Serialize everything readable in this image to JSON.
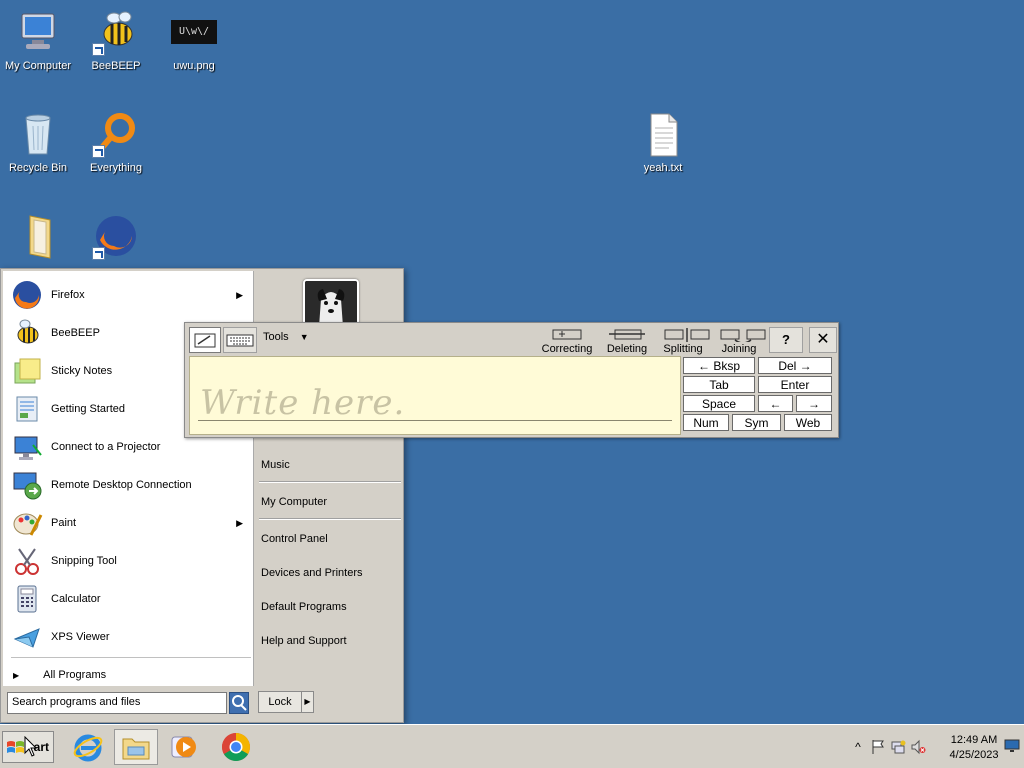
{
  "desktop": {
    "icons": [
      {
        "label": "My Computer"
      },
      {
        "label": "BeeBEEP"
      },
      {
        "label": "uwu.png",
        "thumb_text": "U\\w\\/"
      },
      {
        "label": "Recycle Bin"
      },
      {
        "label": "Everything"
      },
      {
        "label": "yeah.txt"
      }
    ]
  },
  "start_menu": {
    "programs": [
      {
        "label": "Firefox",
        "has_submenu": true
      },
      {
        "label": "BeeBEEP",
        "has_submenu": false
      },
      {
        "label": "Sticky Notes",
        "has_submenu": false
      },
      {
        "label": "Getting Started",
        "has_submenu": false
      },
      {
        "label": "Connect to a Projector",
        "has_submenu": false
      },
      {
        "label": "Remote Desktop Connection",
        "has_submenu": false
      },
      {
        "label": "Paint",
        "has_submenu": true
      },
      {
        "label": "Snipping Tool",
        "has_submenu": false
      },
      {
        "label": "Calculator",
        "has_submenu": false
      },
      {
        "label": "XPS Viewer",
        "has_submenu": false
      }
    ],
    "all_programs": "All Programs",
    "search_placeholder": "Search programs and files",
    "lock_label": "Lock",
    "right_items": [
      "Music",
      "My Computer",
      "Control Panel",
      "Devices and Printers",
      "Default Programs",
      "Help and Support"
    ]
  },
  "input_panel": {
    "tools_label": "Tools",
    "actions": [
      "Correcting",
      "Deleting",
      "Splitting",
      "Joining"
    ],
    "write_hint": "Write here.",
    "keys": {
      "bksp": "← Bksp",
      "del": "Del →",
      "tab": "Tab",
      "enter": "Enter",
      "space": "Space",
      "left": "←",
      "right": "→",
      "num": "Num",
      "sym": "Sym",
      "web": "Web"
    },
    "close_glyph": "✕",
    "help_glyph": "?"
  },
  "taskbar": {
    "start_label": "art",
    "clock_time": "12:49 AM",
    "clock_date": "4/25/2023",
    "tray_expand": "^"
  },
  "colors": {
    "desktop": "#3a6ea5",
    "write_area": "#fffbd7",
    "chrome": "#d4d0c8"
  }
}
